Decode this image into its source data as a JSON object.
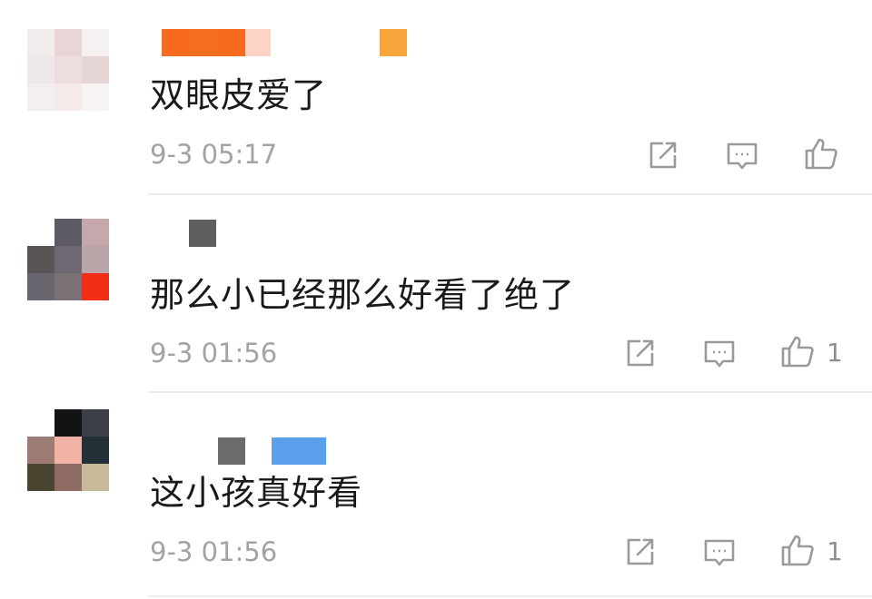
{
  "comments": [
    {
      "text": "双眼皮爱了",
      "time": "9-3 05:17",
      "like_count": "",
      "avatar_colors": [
        "#f1eded",
        "#e9d4d6",
        "#f6f1f1",
        "#efe8e8",
        "#ecdede",
        "#e6d5d5",
        "#f4efef",
        "#f4eaea",
        "#f8f3f3"
      ],
      "name_colors": [
        "#f86a1d",
        "#f46e1f",
        "#fcd4c7",
        "#f8a53c"
      ]
    },
    {
      "text": "那么小已经那么好看了绝了",
      "time": "9-3 01:56",
      "like_count": "1",
      "avatar_colors": [
        "#ffffff",
        "#5d5a66",
        "#c6a7ab",
        "#5b5457",
        "#6e6872",
        "#b9a4a7",
        "#6a6670",
        "#7a7276",
        "#f12f17"
      ],
      "name_colors": [
        "#5f5f5f"
      ]
    },
    {
      "text": "这小孩真好看",
      "time": "9-3 01:56",
      "like_count": "1",
      "avatar_colors": [
        "#ffffff",
        "#121315",
        "#3c4046",
        "#9d7b75",
        "#f1b3a6",
        "#233038",
        "#4a4530",
        "#8e6b62",
        "#c8b99a"
      ],
      "name_colors": [
        "#6b6b6b",
        "#5aa0ec"
      ]
    }
  ],
  "icons": {
    "share": "share-icon",
    "reply": "comment-icon",
    "like": "thumbs-up-icon"
  },
  "colors": {
    "text": "#1a1a1a",
    "meta": "#a3a3a3",
    "icon": "#9a9a9a",
    "divider": "#ececec"
  }
}
